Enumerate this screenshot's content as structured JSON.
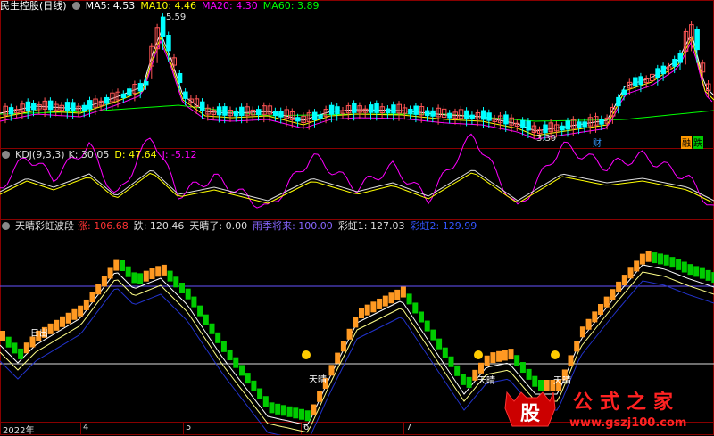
{
  "window_title": "民生控股(日线)",
  "main_panel": {
    "ma_labels": [
      {
        "label": "MA5: 4.53",
        "color": "#ffffff"
      },
      {
        "label": "MA10: 4.46",
        "color": "#ffff00"
      },
      {
        "label": "MA20: 4.30",
        "color": "#ff00ff"
      },
      {
        "label": "MA60: 3.89",
        "color": "#00ff00"
      }
    ],
    "high_marker": "5.59",
    "low_marker": "3.39",
    "event_tags": [
      {
        "text": "财",
        "color": "#3399ff"
      },
      {
        "text": "融",
        "color": "#ff9900"
      },
      {
        "text": "跌",
        "color": "#00cc00"
      }
    ]
  },
  "kdj_panel": {
    "name": "KDJ(9,3,3)",
    "values": [
      {
        "label": "K: 30.05",
        "color": "#dddddd"
      },
      {
        "label": "D: 47.64",
        "color": "#ffff00"
      },
      {
        "label": "J: -5.12",
        "color": "#ff00ff"
      }
    ]
  },
  "rainbow_panel": {
    "name": "天晴彩虹波段",
    "values": [
      {
        "label": "涨: 106.68",
        "color": "#ff3333"
      },
      {
        "label": "跌: 120.46",
        "color": "#dddddd"
      },
      {
        "label": "天晴了: 0.00",
        "color": "#dddddd"
      },
      {
        "label": "雨季将来: 100.00",
        "color": "#8866ff"
      },
      {
        "label": "彩虹1: 127.03",
        "color": "#dddddd"
      },
      {
        "label": "彩虹2: 129.99",
        "color": "#3355ff"
      }
    ],
    "annotations": [
      "日出",
      "天晴",
      "天晴",
      "天晴"
    ]
  },
  "x_axis": [
    "2022年",
    "4",
    "5",
    "6",
    "7"
  ],
  "watermark": {
    "logo": "股",
    "brand": "公式之家",
    "url": "www.gszj100.com"
  },
  "colors": {
    "up": "#ff9922",
    "down": "#00cc00",
    "grid": "#880000",
    "rise": "#ff3333",
    "fall": "#00ffff"
  }
}
